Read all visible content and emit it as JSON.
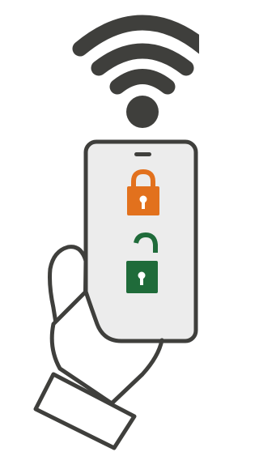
{
  "illustration": {
    "stroke_color": "#3f3f3c",
    "phone_screen_color": "#ececec",
    "locked_padlock_color": "#e2711d",
    "unlocked_padlock_color": "#1f6b3a",
    "hand_fill_color": "#ffffff"
  },
  "icons": {
    "wifi": "wifi-signal-icon",
    "phone": "smartphone-icon",
    "locked": "locked-padlock-icon",
    "unlocked": "unlocked-padlock-icon",
    "hand": "hand-icon"
  }
}
